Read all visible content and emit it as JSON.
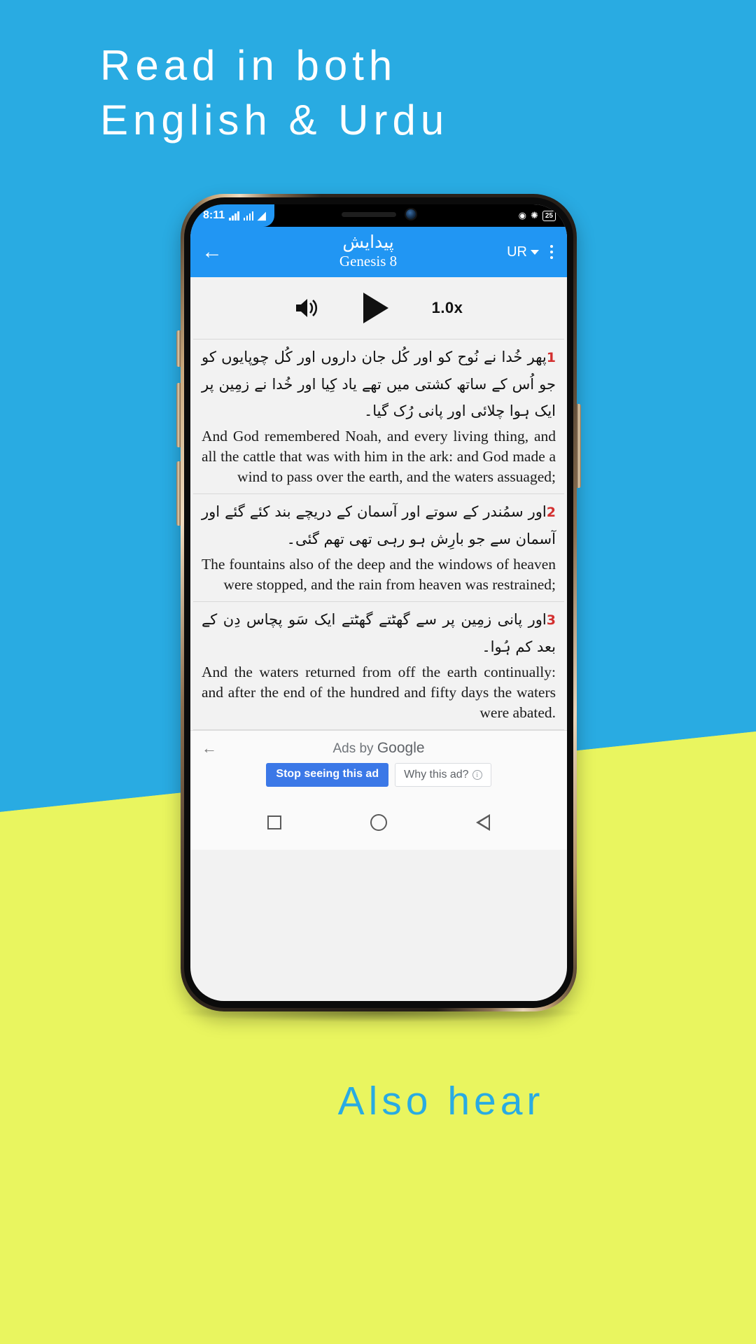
{
  "page": {
    "headline": "Read in both\nEnglish & Urdu",
    "tagline": "Also hear",
    "colors": {
      "top_background": "#29ABE2",
      "bottom_background": "#E9F55F",
      "accent_blue": "#2196F3",
      "verse_number_red": "#D32F2F",
      "ad_button_blue": "#3B78E7"
    }
  },
  "phone": {
    "statusbar": {
      "time": "8:11",
      "signal_icon": "signal-bars-icon",
      "wifi_icon": "wifi-icon",
      "location_icon": "location-icon",
      "bluetooth_icon": "bluetooth-icon",
      "battery_percent": "25"
    },
    "appbar": {
      "back_icon": "back-arrow-icon",
      "title_urdu": "پیدایش",
      "title_english": "Genesis 8",
      "language": "UR",
      "dropdown_icon": "chevron-down-icon",
      "overflow_icon": "overflow-menu-icon"
    },
    "player": {
      "volume_icon": "speaker-icon",
      "play_icon": "play-icon",
      "speed": "1.0x"
    },
    "verses": [
      {
        "number": "1",
        "urdu": "پھر خُدا نے نُوح کو اور کُل جان داروں اور کُل چوپایوں کو جو اُس کے ساتھ کشتی میں تھے یاد کِیا اور خُدا نے زمِین پر ایک ہوا چلائی اور پانی رُک گیا۔",
        "english": "And God remembered Noah, and every living thing, and all the cattle that was with him in the ark: and God made a wind to pass over the earth, and the waters assuaged;"
      },
      {
        "number": "2",
        "urdu": "اور سمُندر کے سوتے اور آسمان کے دریچے بند کئے گئے اور آسمان سے جو بارِش ہو رہی تھی تھم گئی۔",
        "english": "The fountains also of the deep and the windows of heaven were stopped, and the rain from heaven was restrained;"
      },
      {
        "number": "3",
        "urdu": "اور پانی زمِین پر سے گھٹتے گھٹتے ایک سَو پچاس دِن کے بعد کم ہُوا۔",
        "english": "And the waters returned from off the earth continually: and after the end of the hundred and fifty days the waters were abated."
      }
    ],
    "ad": {
      "back_icon": "ad-back-arrow-icon",
      "label_prefix": "Ads by ",
      "label_brand": "Google",
      "stop_button": "Stop seeing this ad",
      "why_button": "Why this ad?",
      "info_icon": "info-icon"
    },
    "navbar": {
      "recents_icon": "square-recents-icon",
      "home_icon": "circle-home-icon",
      "back_icon": "triangle-back-icon"
    }
  }
}
